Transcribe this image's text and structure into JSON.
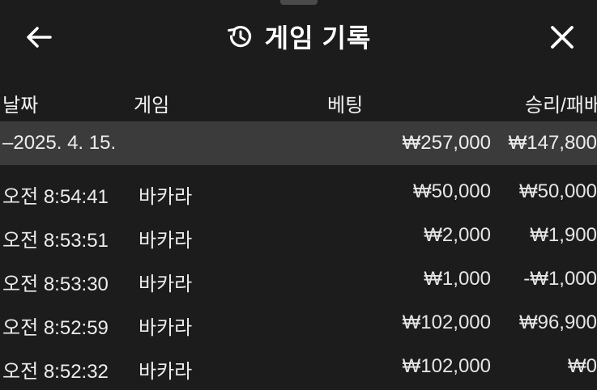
{
  "header": {
    "title": "게임 기록",
    "back_icon": "arrow-left-icon",
    "history_icon": "history-icon",
    "close_icon": "close-icon"
  },
  "columns": {
    "date": "날짜",
    "game": "게임",
    "bet": "베팅",
    "winloss": "승리/패배"
  },
  "group": {
    "label": "–2025. 4. 15.",
    "bet_total": "₩257,000",
    "winloss_total": "₩147,800"
  },
  "rows": [
    {
      "time": "오전 8:54:41",
      "game": "바카라",
      "bet": "₩50,000",
      "winloss": "₩50,000"
    },
    {
      "time": "오전 8:53:51",
      "game": "바카라",
      "bet": "₩2,000",
      "winloss": "₩1,900"
    },
    {
      "time": "오전 8:53:30",
      "game": "바카라",
      "bet": "₩1,000",
      "winloss": "-₩1,000"
    },
    {
      "time": "오전 8:52:59",
      "game": "바카라",
      "bet": "₩102,000",
      "winloss": "₩96,900"
    },
    {
      "time": "오전 8:52:32",
      "game": "바카라",
      "bet": "₩102,000",
      "winloss": "₩0"
    }
  ]
}
